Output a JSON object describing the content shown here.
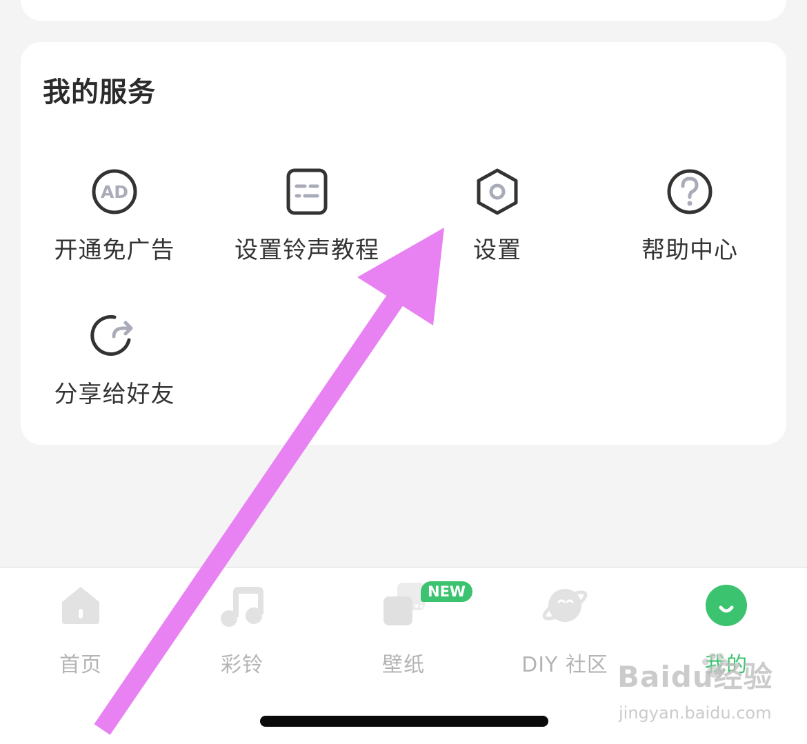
{
  "services": {
    "title": "我的服务",
    "items": [
      {
        "label": "开通免广告",
        "icon": "ad-icon"
      },
      {
        "label": "设置铃声教程",
        "icon": "tutorial-icon"
      },
      {
        "label": "设置",
        "icon": "settings-hexagon-icon"
      },
      {
        "label": "帮助中心",
        "icon": "help-icon"
      },
      {
        "label": "分享给好友",
        "icon": "share-icon"
      }
    ]
  },
  "tabbar": {
    "tabs": [
      {
        "label": "首页",
        "icon": "home-icon"
      },
      {
        "label": "彩铃",
        "icon": "music-note-icon"
      },
      {
        "label": "壁纸",
        "icon": "wallpaper-icon"
      },
      {
        "label": "DIY 社区",
        "icon": "planet-icon"
      },
      {
        "label": "我的",
        "icon": "profile-smile-icon",
        "active": true
      }
    ],
    "new_badge": "NEW"
  },
  "watermark": {
    "logo": "Baidu经验",
    "url": "jingyan.baidu.com"
  },
  "colors": {
    "accent": "#3cc36f",
    "annotation_arrow": "#e882f2",
    "background": "#f4f4f4"
  }
}
